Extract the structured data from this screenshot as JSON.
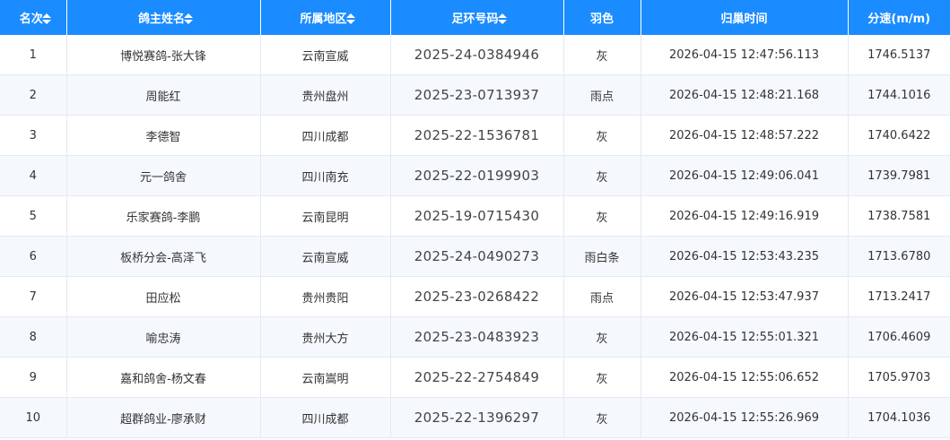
{
  "headers": [
    {
      "label": "名次",
      "sortable": true
    },
    {
      "label": "鸽主姓名",
      "sortable": true
    },
    {
      "label": "所属地区",
      "sortable": true
    },
    {
      "label": "足环号码",
      "sortable": true
    },
    {
      "label": "羽色",
      "sortable": false
    },
    {
      "label": "归巢时间",
      "sortable": false
    },
    {
      "label": "分速(m/m)",
      "sortable": false
    }
  ],
  "rows": [
    [
      "1",
      "博悦赛鸽-张大锋",
      "云南宣威",
      "2025-24-0384946",
      "灰",
      "2026-04-15 12:47:56.113",
      "1746.5137"
    ],
    [
      "2",
      "周能红",
      "贵州盘州",
      "2025-23-0713937",
      "雨点",
      "2026-04-15 12:48:21.168",
      "1744.1016"
    ],
    [
      "3",
      "李德智",
      "四川成都",
      "2025-22-1536781",
      "灰",
      "2026-04-15 12:48:57.222",
      "1740.6422"
    ],
    [
      "4",
      "元一鸽舍",
      "四川南充",
      "2025-22-0199903",
      "灰",
      "2026-04-15 12:49:06.041",
      "1739.7981"
    ],
    [
      "5",
      "乐家赛鸽-李鹏",
      "云南昆明",
      "2025-19-0715430",
      "灰",
      "2026-04-15 12:49:16.919",
      "1738.7581"
    ],
    [
      "6",
      "板桥分会-高泽飞",
      "云南宣威",
      "2025-24-0490273",
      "雨白条",
      "2026-04-15 12:53:43.235",
      "1713.6780"
    ],
    [
      "7",
      "田应松",
      "贵州贵阳",
      "2025-23-0268422",
      "雨点",
      "2026-04-15 12:53:47.937",
      "1713.2417"
    ],
    [
      "8",
      "喻忠涛",
      "贵州大方",
      "2025-23-0483923",
      "灰",
      "2026-04-15 12:55:01.321",
      "1706.4609"
    ],
    [
      "9",
      "嘉和鸽舍-杨文春",
      "云南嵩明",
      "2025-22-2754849",
      "灰",
      "2026-04-15 12:55:06.652",
      "1705.9703"
    ],
    [
      "10",
      "超群鸽业-廖承财",
      "四川成都",
      "2025-22-1396297",
      "灰",
      "2026-04-15 12:55:26.969",
      "1704.1036"
    ]
  ],
  "colors": {
    "header_bg": "#1a8cff",
    "header_text": "#ffffff",
    "stripe": "#f5f8fc",
    "border": "#e6e9ee"
  }
}
